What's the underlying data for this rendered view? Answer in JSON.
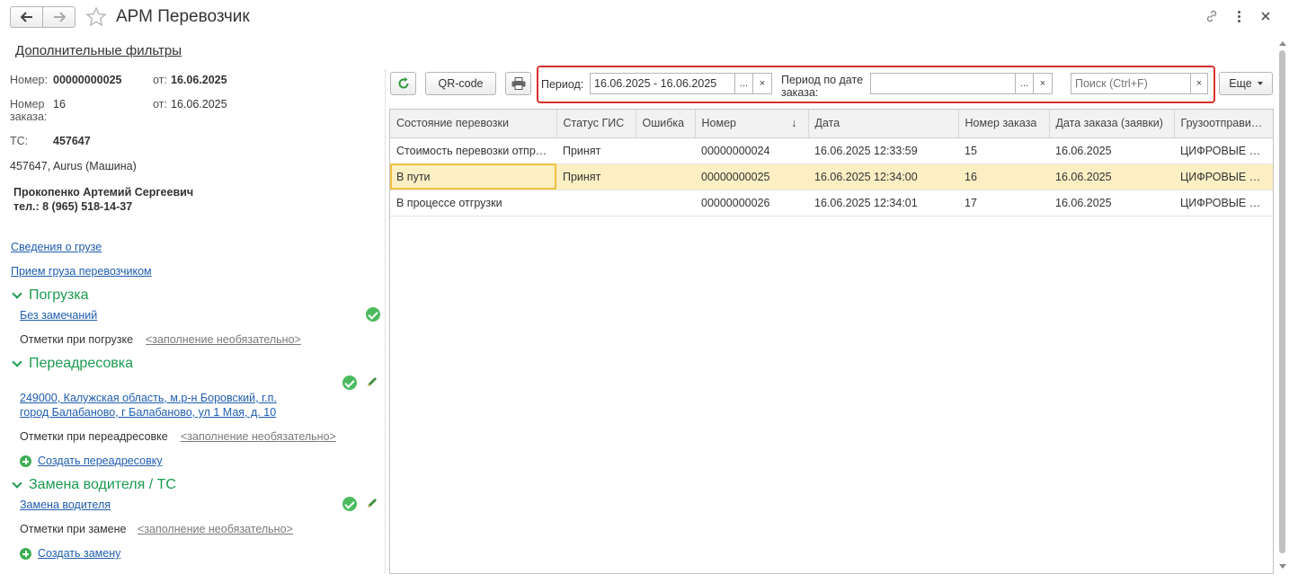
{
  "window": {
    "title": "АРМ Перевозчик"
  },
  "filters_link": "Дополнительные фильтры",
  "left": {
    "number_label": "Номер:",
    "number_value": "00000000025",
    "from_label": "от:",
    "from_value": "16.06.2025",
    "order_label": "Номер заказа:",
    "order_value": "16",
    "order_from_label": "от:",
    "order_from_value": "16.06.2025",
    "ts_label": "ТС:",
    "ts_value": "457647",
    "vehicle": "457647, Aurus (Машина)",
    "driver_name": "Прокопенко Артемий Сергеевич",
    "driver_phone": "тел.: 8 (965) 518-14-37",
    "cargo_link": "Сведения о грузе",
    "accept_link": "Прием груза перевозчиком",
    "loading": {
      "title": "Погрузка",
      "status_link": "Без замечаний",
      "notes_label": "Отметки при погрузке",
      "notes_placeholder": "<заполнение необязательно>"
    },
    "redirect": {
      "title": "Переадресовка",
      "address_line1": "249000, Калужская область, м.р-н Боровский, г.п.",
      "address_line2": "город Балабаново, г Балабаново, ул 1 Мая, д. 10",
      "notes_label": "Отметки при переадресовке",
      "notes_placeholder": "<заполнение необязательно>",
      "create_link": "Создать переадресовку"
    },
    "driver_change": {
      "title": "Замена водителя / ТС",
      "link": "Замена водителя",
      "notes_label": "Отметки при замене",
      "notes_placeholder": "<заполнение необязательно>",
      "create_link": "Создать замену"
    }
  },
  "toolbar": {
    "qr_label": "QR-code",
    "period_label": "Период:",
    "period_value": "16.06.2025 - 16.06.2025",
    "order_period_label": "Период по дате заказа:",
    "order_period_value": "",
    "search_placeholder": "Поиск (Ctrl+F)",
    "more_label": "Еще",
    "dots": "...",
    "clear": "×"
  },
  "table": {
    "columns": [
      "Состояние перевозки",
      "Статус ГИС",
      "Ошибка",
      "Номер",
      "Дата",
      "Номер заказа",
      "Дата заказа (заявки)",
      "Грузоотправитель"
    ],
    "sort_indicator": "↓",
    "rows": [
      [
        "Стоимость перевозки отправлена",
        "Принят",
        "",
        "00000000024",
        "16.06.2025 12:33:59",
        "15",
        "16.06.2025",
        "ЦИФРОВЫЕ ТЕХНОЛОГИИ"
      ],
      [
        "В пути",
        "Принят",
        "",
        "00000000025",
        "16.06.2025 12:34:00",
        "16",
        "16.06.2025",
        "ЦИФРОВЫЕ ТЕХНОЛОГИИ"
      ],
      [
        "В процессе отгрузки",
        "",
        "",
        "00000000026",
        "16.06.2025 12:34:01",
        "17",
        "16.06.2025",
        "ЦИФРОВЫЕ ТЕХНОЛОГИИ"
      ]
    ],
    "selected_row": 1
  },
  "colors": {
    "accent_green": "#1a9b4f",
    "link_blue": "#1f5db0",
    "highlight_red": "#d9302b",
    "selection": "#fcefc4"
  }
}
